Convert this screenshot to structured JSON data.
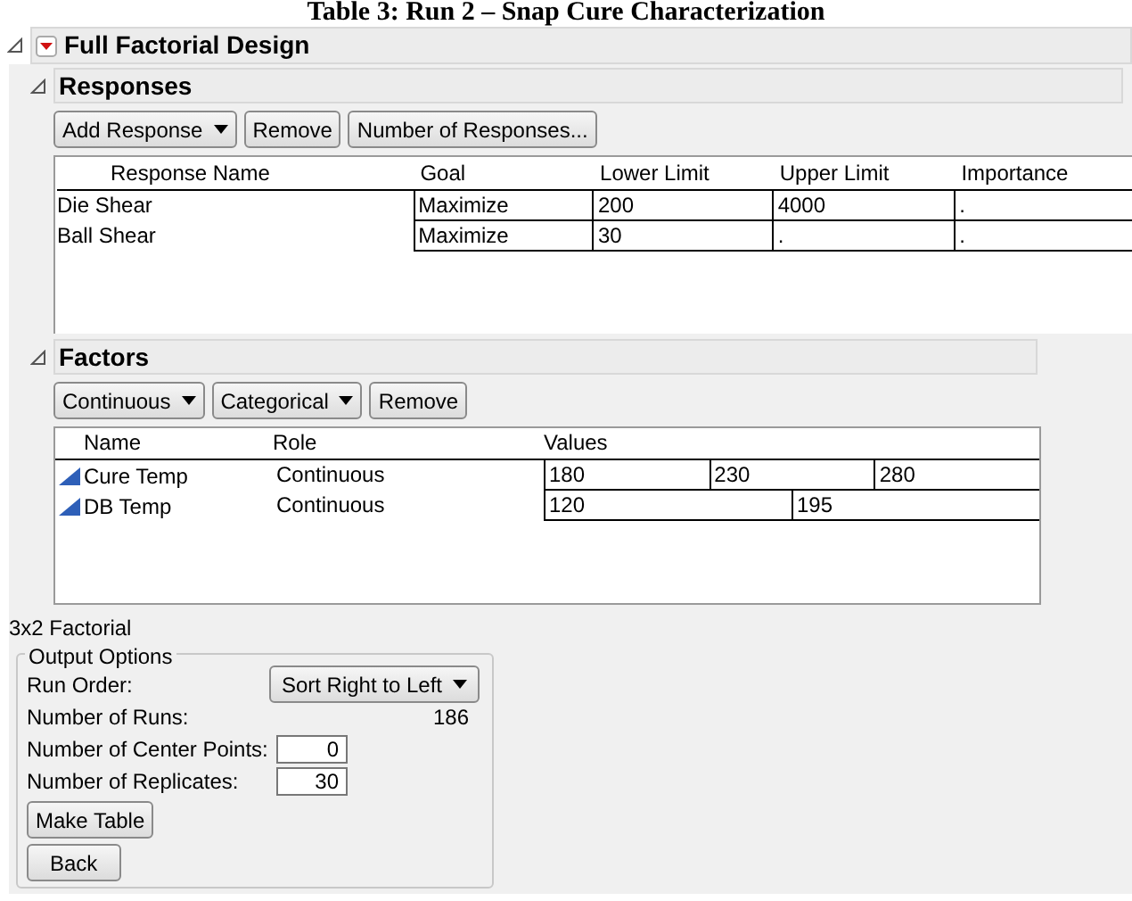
{
  "caption": "Table 3: Run 2 – Snap Cure Characterization",
  "title": "Full Factorial Design",
  "responses": {
    "title": "Responses",
    "buttons": [
      {
        "label": "Add Response",
        "dropdown": true
      },
      {
        "label": "Remove",
        "dropdown": false
      },
      {
        "label": "Number of Responses...",
        "dropdown": false
      }
    ],
    "columns": [
      "Response Name",
      "Goal",
      "Lower Limit",
      "Upper Limit",
      "Importance"
    ],
    "rows": [
      {
        "name": "Die Shear",
        "goal": "Maximize",
        "lower_limit": "200",
        "upper_limit": "4000",
        "importance": "."
      },
      {
        "name": "Ball Shear",
        "goal": "Maximize",
        "lower_limit": "30",
        "upper_limit": ".",
        "importance": "."
      }
    ]
  },
  "factors": {
    "title": "Factors",
    "buttons": [
      {
        "label": "Continuous",
        "dropdown": true
      },
      {
        "label": "Categorical",
        "dropdown": true
      },
      {
        "label": "Remove",
        "dropdown": false
      }
    ],
    "columns": [
      "Name",
      "Role",
      "Values"
    ],
    "rows": [
      {
        "name": "Cure Temp",
        "role": "Continuous",
        "values": [
          "180",
          "230",
          "280"
        ]
      },
      {
        "name": "DB Temp",
        "role": "Continuous",
        "values": [
          "120",
          "195"
        ]
      }
    ]
  },
  "design_summary": "3x2 Factorial",
  "output_options": {
    "title": "Output Options",
    "run_order_label": "Run Order:",
    "run_order": "Sort Right to Left",
    "runs_label": "Number of Runs:",
    "runs": "186",
    "center_points_label": "Number of Center Points:",
    "center_points": "0",
    "replicates_label": "Number of Replicates:",
    "replicates": "30",
    "buttons": [
      "Make Table",
      "Back"
    ]
  }
}
